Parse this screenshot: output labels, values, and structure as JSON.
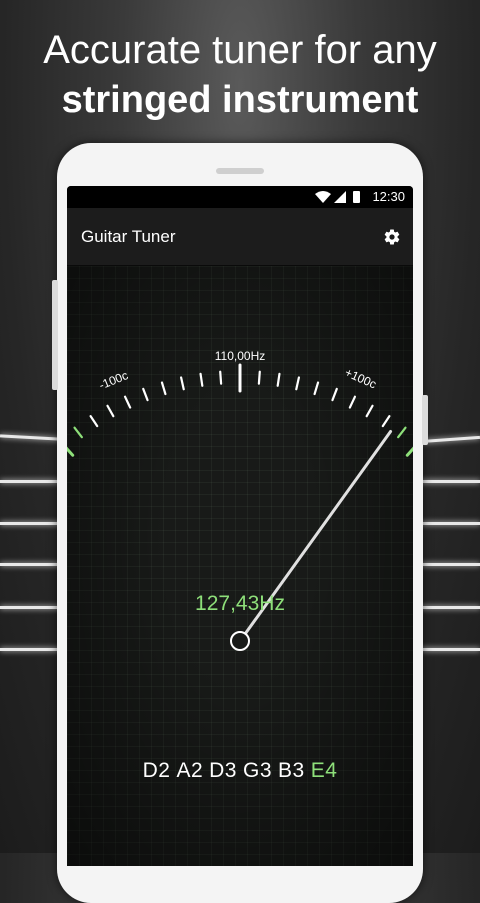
{
  "headline": {
    "line1": "Accurate tuner for any",
    "line2": "stringed instrument"
  },
  "status_bar": {
    "time": "12:30",
    "icons": [
      "wifi-icon",
      "signal-icon",
      "battery-icon"
    ]
  },
  "app_bar": {
    "title": "Guitar Tuner",
    "settings_icon": "gear-icon"
  },
  "gauge": {
    "left_label": "-100c",
    "center_label": "110,00Hz",
    "right_label": "+100c",
    "needle_cents": 85
  },
  "reading": {
    "frequency": "127,43Hz"
  },
  "notes": [
    {
      "label": "D2",
      "active": false
    },
    {
      "label": "A2",
      "active": false
    },
    {
      "label": "D3",
      "active": false
    },
    {
      "label": "G3",
      "active": false
    },
    {
      "label": "B3",
      "active": false
    },
    {
      "label": "E4",
      "active": true
    }
  ],
  "colors": {
    "accent": "#8ee07a",
    "background": "#181a18"
  }
}
